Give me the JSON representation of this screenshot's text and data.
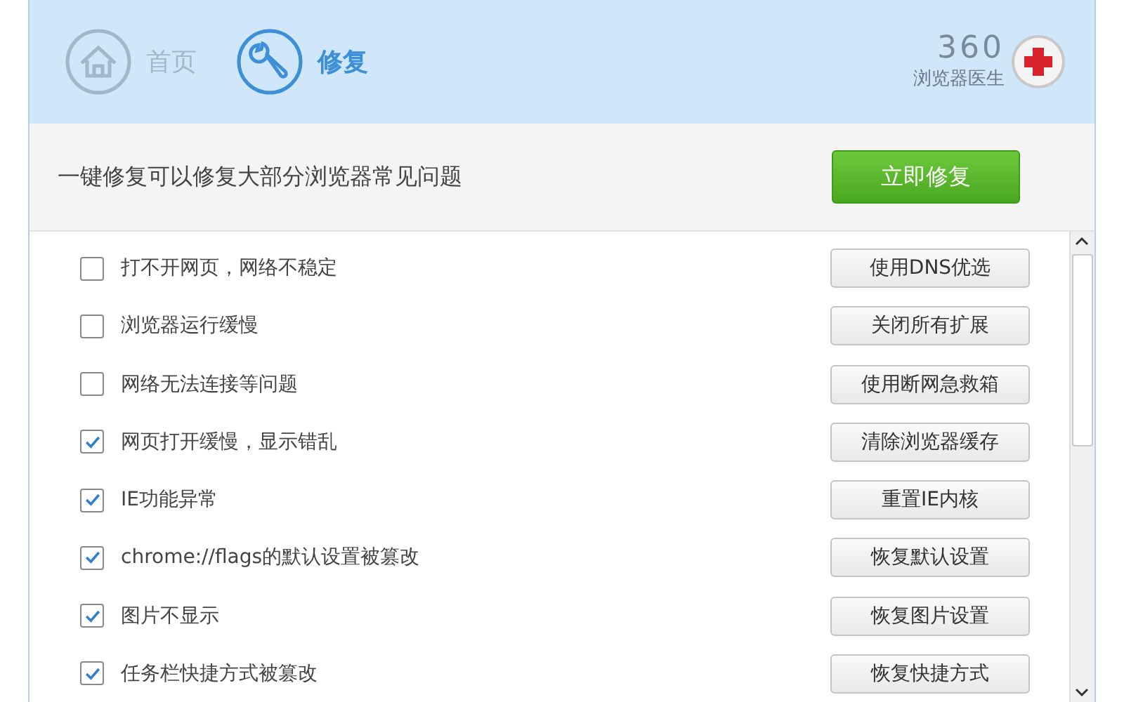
{
  "tabs": [
    {
      "label": "首页",
      "selected": false
    },
    {
      "label": "修复",
      "selected": true
    }
  ],
  "brand": {
    "name": "360",
    "subtitle": "浏览器医生"
  },
  "banner": {
    "text": "一键修复可以修复大部分浏览器常见问题",
    "button": "立即修复"
  },
  "issues": [
    {
      "label": "打不开网页，网络不稳定",
      "checked": false,
      "action": "使用DNS优选"
    },
    {
      "label": "浏览器运行缓慢",
      "checked": false,
      "action": "关闭所有扩展"
    },
    {
      "label": "网络无法连接等问题",
      "checked": false,
      "action": "使用断网急救箱"
    },
    {
      "label": "网页打开缓慢，显示错乱",
      "checked": true,
      "action": "清除浏览器缓存"
    },
    {
      "label": "IE功能异常",
      "checked": true,
      "action": "重置IE内核"
    },
    {
      "label": "chrome://flags的默认设置被篡改",
      "checked": true,
      "action": "恢复默认设置"
    },
    {
      "label": "图片不显示",
      "checked": true,
      "action": "恢复图片设置"
    },
    {
      "label": "任务栏快捷方式被篡改",
      "checked": true,
      "action": "恢复快捷方式"
    }
  ]
}
